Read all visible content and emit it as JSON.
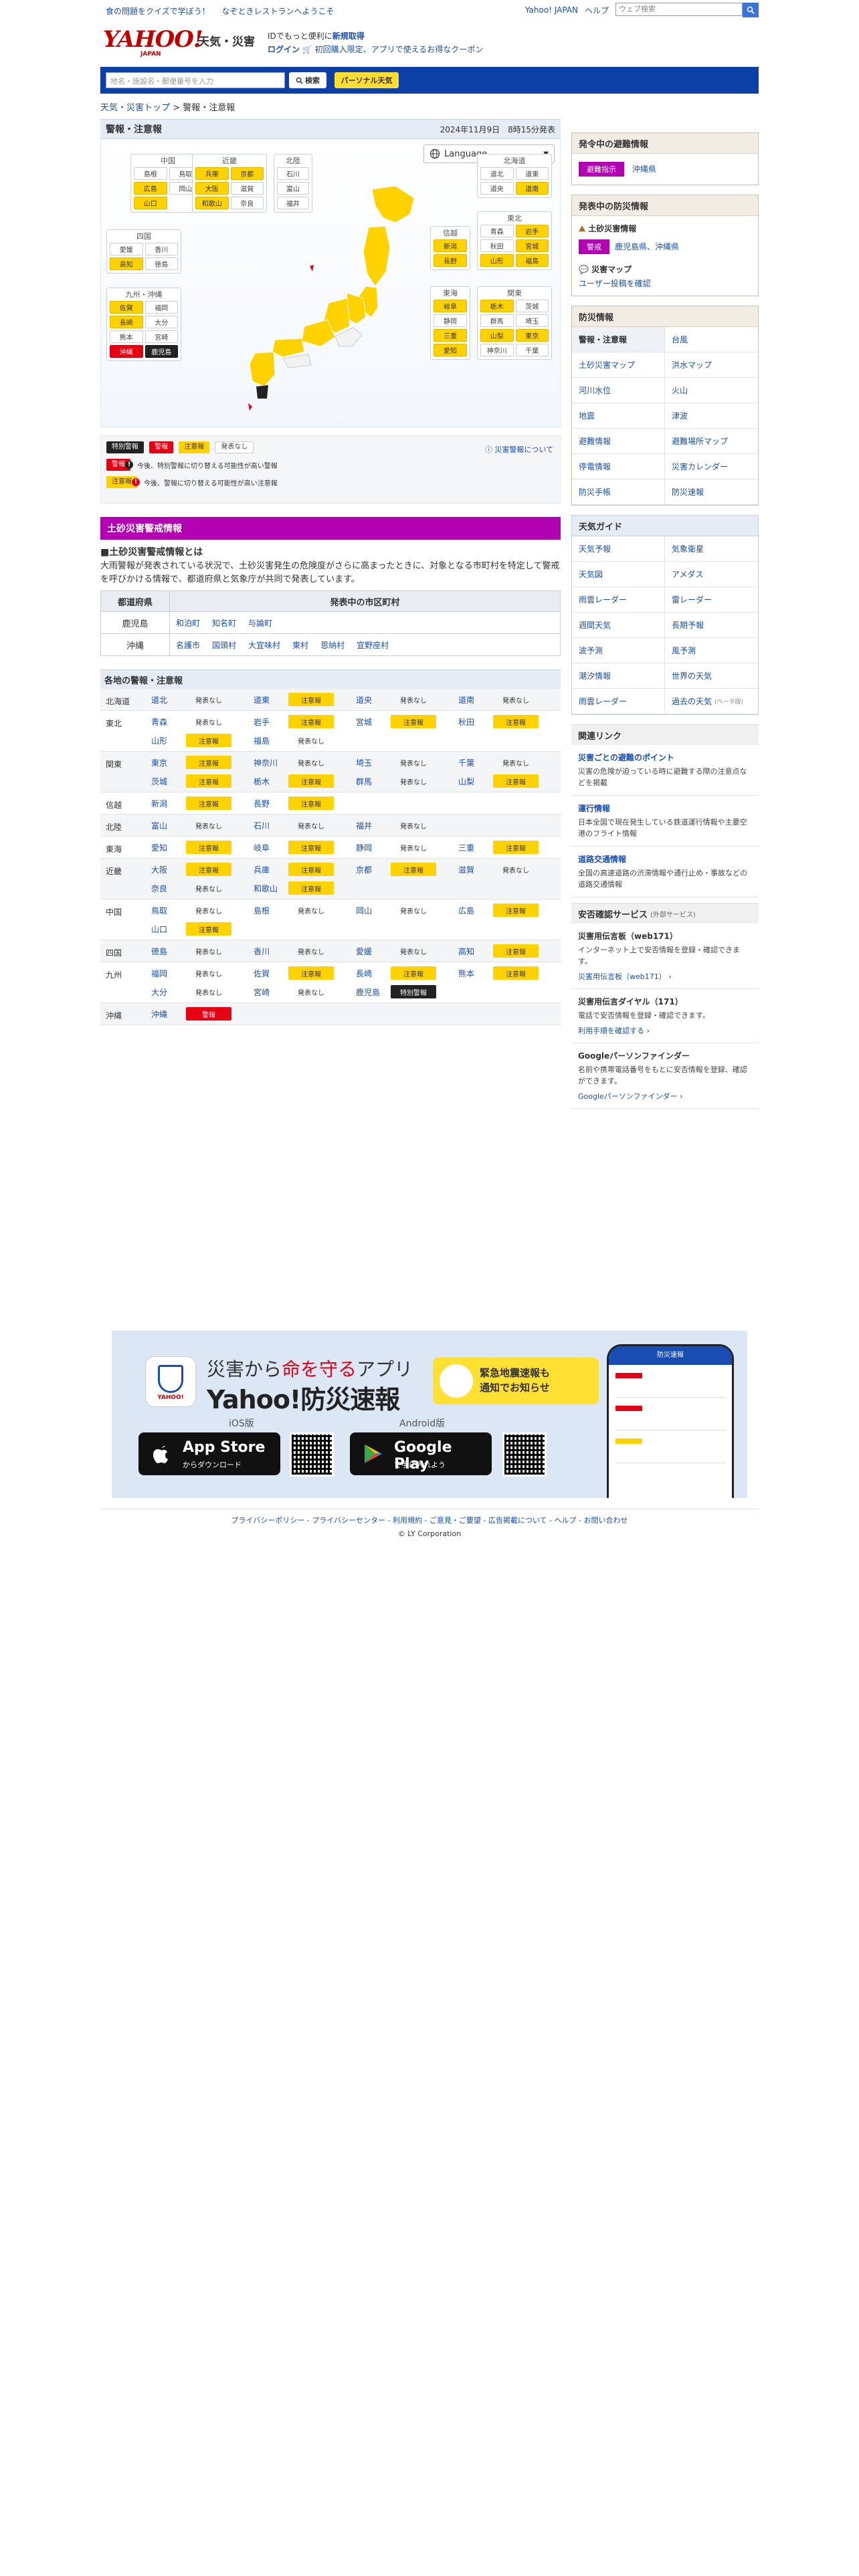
{
  "header": {
    "promo_links": [
      "食の問題をクイズで学ぼう！",
      "なぞときレストランへようこそ"
    ],
    "right_links": [
      "Yahoo! JAPAN",
      "ヘルプ"
    ],
    "web_search_placeholder": "ウェブ検索",
    "logo_text": "YAHOO!",
    "logo_sub": "JAPAN",
    "site_name": "天気・災害",
    "id_line_prefix": "IDでもっと便利に",
    "id_register": "新規取得",
    "login": "ログイン",
    "coupon_text": "初回購入限定、アプリで使えるお得なクーポン"
  },
  "searchbar": {
    "placeholder": "地名・施設名・郵便番号を入力",
    "search_label": "検索",
    "personal_label": "パーソナル天気"
  },
  "breadcrumb": [
    "天気・災害トップ",
    "警報・注意報"
  ],
  "main": {
    "title": "警報・注意報",
    "datetime": "2024年11月9日　8時15分発表",
    "language_label": "Language",
    "regions": [
      {
        "name": "中国",
        "cells": [
          {
            "n": "島根",
            "s": "n"
          },
          {
            "n": "鳥取",
            "s": "n"
          },
          {
            "n": "広島",
            "s": "y"
          },
          {
            "n": "岡山",
            "s": "n"
          },
          {
            "n": "山口",
            "s": "y"
          }
        ]
      },
      {
        "name": "近畿",
        "cells": [
          {
            "n": "兵庫",
            "s": "y"
          },
          {
            "n": "京都",
            "s": "y"
          },
          {
            "n": "大阪",
            "s": "y"
          },
          {
            "n": "滋賀",
            "s": "n"
          },
          {
            "n": "和歌山",
            "s": "y"
          },
          {
            "n": "奈良",
            "s": "n"
          }
        ]
      },
      {
        "name": "北陸",
        "cells": [
          {
            "n": "石川",
            "s": "n"
          },
          {
            "n": "富山",
            "s": "n"
          },
          {
            "n": "福井",
            "s": "n"
          }
        ]
      },
      {
        "name": "北海道",
        "cells": [
          {
            "n": "道北",
            "s": "n"
          },
          {
            "n": "道東",
            "s": "n"
          },
          {
            "n": "道央",
            "s": "n"
          },
          {
            "n": "道南",
            "s": "y"
          }
        ]
      },
      {
        "name": "四国",
        "cells": [
          {
            "n": "愛媛",
            "s": "n"
          },
          {
            "n": "香川",
            "s": "n"
          },
          {
            "n": "高知",
            "s": "y"
          },
          {
            "n": "徳島",
            "s": "n"
          }
        ]
      },
      {
        "name": "東北",
        "cells": [
          {
            "n": "青森",
            "s": "n"
          },
          {
            "n": "岩手",
            "s": "y"
          },
          {
            "n": "秋田",
            "s": "n"
          },
          {
            "n": "宮城",
            "s": "y"
          },
          {
            "n": "山形",
            "s": "y"
          },
          {
            "n": "福島",
            "s": "y"
          }
        ]
      },
      {
        "name": "信越",
        "cells": [
          {
            "n": "新潟",
            "s": "y"
          },
          {
            "n": "長野",
            "s": "y"
          }
        ]
      },
      {
        "name": "九州・沖縄",
        "cells": [
          {
            "n": "佐賀",
            "s": "y"
          },
          {
            "n": "福岡",
            "s": "n"
          },
          {
            "n": "長崎",
            "s": "y"
          },
          {
            "n": "大分",
            "s": "n"
          },
          {
            "n": "熊本",
            "s": "n"
          },
          {
            "n": "宮崎",
            "s": "n"
          },
          {
            "n": "沖縄",
            "s": "r"
          },
          {
            "n": "鹿児島",
            "s": "k"
          }
        ]
      },
      {
        "name": "東海",
        "cells": [
          {
            "n": "岐阜",
            "s": "y"
          },
          {
            "n": "静岡",
            "s": "n"
          },
          {
            "n": "三重",
            "s": "y"
          },
          {
            "n": "愛知",
            "s": "y"
          }
        ]
      },
      {
        "name": "関東",
        "cells": [
          {
            "n": "栃木",
            "s": "y"
          },
          {
            "n": "茨城",
            "s": "n"
          },
          {
            "n": "群馬",
            "s": "n"
          },
          {
            "n": "埼玉",
            "s": "n"
          },
          {
            "n": "山梨",
            "s": "y"
          },
          {
            "n": "東京",
            "s": "y"
          },
          {
            "n": "神奈川",
            "s": "n"
          },
          {
            "n": "千葉",
            "s": "n"
          }
        ]
      }
    ],
    "legend": {
      "tags": [
        {
          "label": "特別警報",
          "s": "k"
        },
        {
          "label": "警報",
          "s": "r"
        },
        {
          "label": "注意報",
          "s": "y"
        },
        {
          "label": "発表なし",
          "s": "n"
        }
      ],
      "about_link": "災害警報について",
      "warn_tag": "警報",
      "warn_text": "今後、特別警報に切り替える可能性が高い警報",
      "adv_tag": "注意報",
      "adv_text": "今後、警報に切り替える可能性が高い注意報"
    },
    "sabo": {
      "title": "土砂災害警戒情報",
      "subtitle": "■土砂災害警戒情報とは",
      "description": "大雨警報が発表されている状況で、土砂災害発生の危険度がさらに高まったときに、対象となる市町村を特定して警戒を呼びかける情報で、都道府県と気象庁が共同で発表しています。",
      "col_pref": "都道府県",
      "col_cities": "発表中の市区町村",
      "rows": [
        {
          "pref": "鹿児島",
          "cities": [
            "和泊町",
            "知名町",
            "与論町"
          ]
        },
        {
          "pref": "沖縄",
          "cities": [
            "名護市",
            "国頭村",
            "大宜味村",
            "東村",
            "恩納村",
            "宜野座村"
          ]
        }
      ]
    },
    "areas_title": "各地の警報・注意報",
    "areas": [
      {
        "region": "北海道",
        "prefs": [
          {
            "n": "道北",
            "s": "n",
            "t": "発表なし"
          },
          {
            "n": "道東",
            "s": "y",
            "t": "注意報"
          },
          {
            "n": "道央",
            "s": "n",
            "t": "発表なし"
          },
          {
            "n": "道南",
            "s": "n",
            "t": "発表なし"
          }
        ]
      },
      {
        "region": "東北",
        "prefs": [
          {
            "n": "青森",
            "s": "n",
            "t": "発表なし"
          },
          {
            "n": "岩手",
            "s": "y",
            "t": "注意報"
          },
          {
            "n": "宮城",
            "s": "y",
            "t": "注意報"
          },
          {
            "n": "秋田",
            "s": "y",
            "t": "注意報"
          },
          {
            "n": "山形",
            "s": "y",
            "t": "注意報"
          },
          {
            "n": "福島",
            "s": "n",
            "t": "発表なし"
          }
        ]
      },
      {
        "region": "関東",
        "prefs": [
          {
            "n": "東京",
            "s": "y",
            "t": "注意報"
          },
          {
            "n": "神奈川",
            "s": "n",
            "t": "発表なし"
          },
          {
            "n": "埼玉",
            "s": "n",
            "t": "発表なし"
          },
          {
            "n": "千葉",
            "s": "n",
            "t": "発表なし"
          },
          {
            "n": "茨城",
            "s": "y",
            "t": "注意報"
          },
          {
            "n": "栃木",
            "s": "y",
            "t": "注意報"
          },
          {
            "n": "群馬",
            "s": "n",
            "t": "発表なし"
          },
          {
            "n": "山梨",
            "s": "y",
            "t": "注意報"
          }
        ]
      },
      {
        "region": "信越",
        "prefs": [
          {
            "n": "新潟",
            "s": "y",
            "t": "注意報"
          },
          {
            "n": "長野",
            "s": "y",
            "t": "注意報"
          }
        ]
      },
      {
        "region": "北陸",
        "prefs": [
          {
            "n": "富山",
            "s": "n",
            "t": "発表なし"
          },
          {
            "n": "石川",
            "s": "n",
            "t": "発表なし"
          },
          {
            "n": "福井",
            "s": "n",
            "t": "発表なし"
          }
        ]
      },
      {
        "region": "東海",
        "prefs": [
          {
            "n": "愛知",
            "s": "y",
            "t": "注意報"
          },
          {
            "n": "岐阜",
            "s": "y",
            "t": "注意報"
          },
          {
            "n": "静岡",
            "s": "n",
            "t": "発表なし"
          },
          {
            "n": "三重",
            "s": "y",
            "t": "注意報"
          }
        ]
      },
      {
        "region": "近畿",
        "prefs": [
          {
            "n": "大阪",
            "s": "y",
            "t": "注意報"
          },
          {
            "n": "兵庫",
            "s": "y",
            "t": "注意報"
          },
          {
            "n": "京都",
            "s": "y",
            "t": "注意報"
          },
          {
            "n": "滋賀",
            "s": "n",
            "t": "発表なし"
          },
          {
            "n": "奈良",
            "s": "n",
            "t": "発表なし"
          },
          {
            "n": "和歌山",
            "s": "y",
            "t": "注意報"
          }
        ]
      },
      {
        "region": "中国",
        "prefs": [
          {
            "n": "鳥取",
            "s": "n",
            "t": "発表なし"
          },
          {
            "n": "島根",
            "s": "n",
            "t": "発表なし"
          },
          {
            "n": "岡山",
            "s": "n",
            "t": "発表なし"
          },
          {
            "n": "広島",
            "s": "y",
            "t": "注意報"
          },
          {
            "n": "山口",
            "s": "y",
            "t": "注意報"
          }
        ]
      },
      {
        "region": "四国",
        "prefs": [
          {
            "n": "徳島",
            "s": "n",
            "t": "発表なし"
          },
          {
            "n": "香川",
            "s": "n",
            "t": "発表なし"
          },
          {
            "n": "愛媛",
            "s": "n",
            "t": "発表なし"
          },
          {
            "n": "高知",
            "s": "y",
            "t": "注意報"
          }
        ]
      },
      {
        "region": "九州",
        "prefs": [
          {
            "n": "福岡",
            "s": "n",
            "t": "発表なし"
          },
          {
            "n": "佐賀",
            "s": "y",
            "t": "注意報"
          },
          {
            "n": "長崎",
            "s": "y",
            "t": "注意報"
          },
          {
            "n": "熊本",
            "s": "y",
            "t": "注意報"
          },
          {
            "n": "大分",
            "s": "n",
            "t": "発表なし"
          },
          {
            "n": "宮崎",
            "s": "n",
            "t": "発表なし"
          },
          {
            "n": "鹿児島",
            "s": "k",
            "t": "特別警報"
          }
        ]
      },
      {
        "region": "沖縄",
        "prefs": [
          {
            "n": "沖縄",
            "s": "r",
            "t": "警報"
          }
        ]
      }
    ]
  },
  "sidebar": {
    "evac": {
      "title": "発令中の避難情報",
      "badge": "避難指示",
      "link": "沖縄県"
    },
    "bosai": {
      "title": "発表中の防災情報",
      "sabo_label": "土砂災害情報",
      "warn_badge": "警戒",
      "warn_link": "鹿児島県、沖縄県",
      "map_label": "災害マップ",
      "map_link": "ユーザー投稿を確認"
    },
    "bosai_info": {
      "title": "防災情報",
      "items": [
        "警報・注意報",
        "台風",
        "土砂災害マップ",
        "洪水マップ",
        "河川水位",
        "火山",
        "地震",
        "津波",
        "避難情報",
        "避難場所マップ",
        "停電情報",
        "災害カレンダー",
        "防災手帳",
        "防災速報"
      ]
    },
    "weather_guide": {
      "title": "天気ガイド",
      "items": [
        "天気予報",
        "気象衛星",
        "天気図",
        "アメダス",
        "雨雲レーダー",
        "雷レーダー",
        "週間天気",
        "長期予報",
        "波予測",
        "風予測",
        "潮汐情報",
        "世界の天気",
        "雨雲レーダー",
        "過去の天気"
      ],
      "beta": "(ベータ版)"
    },
    "related": {
      "title": "関連リンク",
      "items": [
        {
          "t": "災害ごとの避難のポイント",
          "d": "災害の危険が迫っている時に避難する際の注意点などを掲載"
        },
        {
          "t": "運行情報",
          "d": "日本全国で現在発生している鉄道運行情報や主要空港のフライト情報"
        },
        {
          "t": "道路交通情報",
          "d": "全国の高速道路の渋滞情報や通行止め・事故などの道路交通情報"
        }
      ]
    },
    "safety": {
      "title": "安否確認サービス",
      "note": "(外部サービス)",
      "items": [
        {
          "t": "災害用伝言板（web171）",
          "d": "インターネット上で安否情報を登録・確認できます。",
          "l": "災害用伝言板（web171）"
        },
        {
          "t": "災害用伝言ダイヤル（171）",
          "d": "電話で安否情報を登録・確認できます。",
          "l": "利用手順を確認する"
        },
        {
          "t": "Googleパーソンファインダー",
          "d": "名前や携帯電話番号をもとに安否情報を登録、確認ができます。",
          "l": "Googleパーソンファインダー"
        }
      ]
    }
  },
  "banner": {
    "tagline_pre": "災害から",
    "tagline_em": "命を守る",
    "tagline_post": "アプリ",
    "app_name": "Yahoo!防災速報",
    "app_icon_text": "YAHOO!",
    "bubble": "緊急地震速報も\n通知でお知らせ",
    "ios_label": "iOS版",
    "android_label": "Android版",
    "appstore_main": "App Store",
    "appstore_sub": "からダウンロード",
    "gplay_main": "Google Play",
    "gplay_sub": "で手に入れよう",
    "phone_header": "防災速報"
  },
  "footer": {
    "links": "プライバシーポリシー - プライバシーセンター - 利用規約 - ご意見・ご要望 - 広告掲載について - ヘルプ - お問い合わせ",
    "copyright": "© LY Corporation"
  },
  "colors": {
    "warning": "#e60012",
    "advisory": "#ffd200",
    "special": "#222222",
    "sabo": "#b200b2",
    "brand_blue": "#0d3fa8"
  }
}
